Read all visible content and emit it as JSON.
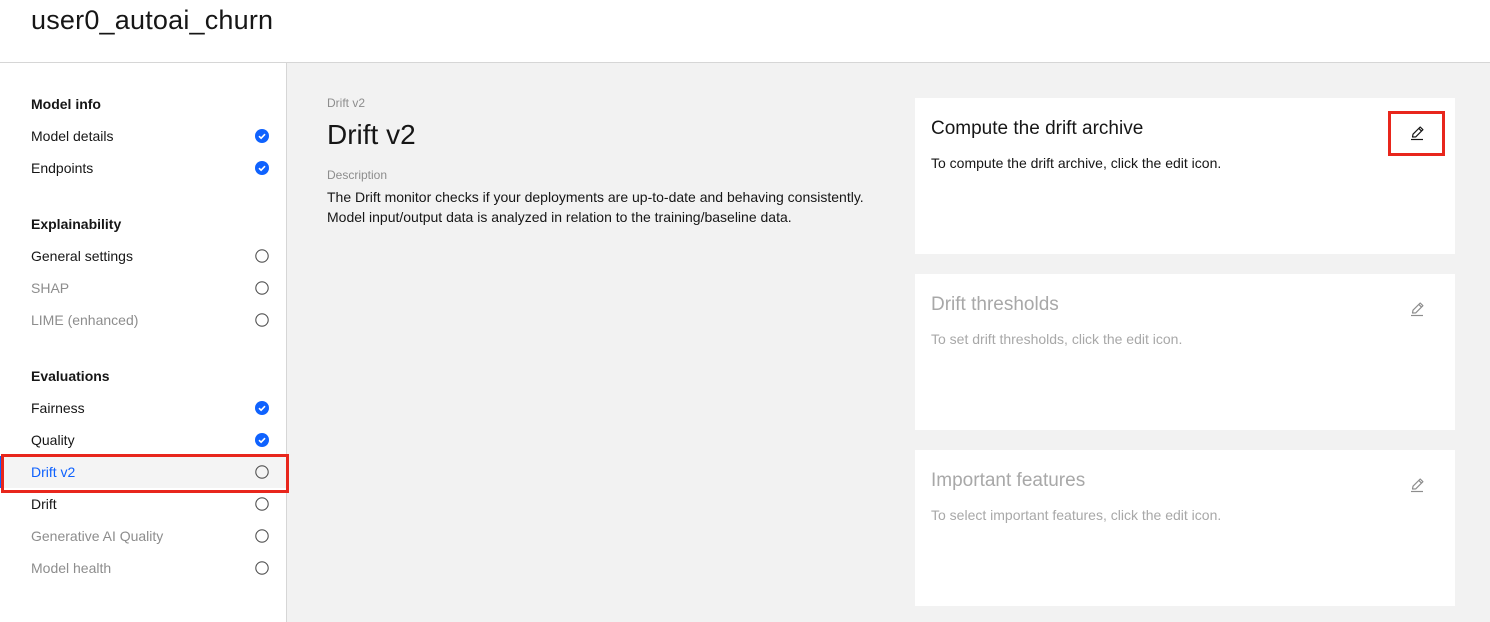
{
  "app": {
    "title": "user0_autoai_churn"
  },
  "sidebar": {
    "sections": [
      {
        "title": "Model info"
      },
      {
        "title": "Explainability"
      },
      {
        "title": "Evaluations"
      }
    ],
    "items": [
      {
        "label": "Model details",
        "status": "complete"
      },
      {
        "label": "Endpoints",
        "status": "complete"
      },
      {
        "label": "General settings",
        "status": "incomplete"
      },
      {
        "label": "SHAP",
        "status": "incomplete",
        "disabled": true
      },
      {
        "label": "LIME (enhanced)",
        "status": "incomplete",
        "disabled": true
      },
      {
        "label": "Fairness",
        "status": "complete"
      },
      {
        "label": "Quality",
        "status": "complete"
      },
      {
        "label": "Drift v2",
        "status": "incomplete",
        "selected": true
      },
      {
        "label": "Drift",
        "status": "incomplete"
      },
      {
        "label": "Generative AI Quality",
        "status": "incomplete",
        "disabled": true
      },
      {
        "label": "Model health",
        "status": "incomplete",
        "disabled": true
      }
    ]
  },
  "main": {
    "breadcrumb": "Drift v2",
    "title": "Drift v2",
    "description_label": "Description",
    "description": "The Drift monitor checks if your deployments are up-to-date and behaving consistently. Model input/output data is analyzed in relation to the training/baseline data.",
    "cards": [
      {
        "title": "Compute the drift archive",
        "text": "To compute the drift archive, click the edit icon.",
        "icon": "edit-icon"
      },
      {
        "title": "Drift thresholds",
        "text": "To set drift thresholds, click the edit icon.",
        "icon": "edit-icon",
        "disabled": true
      },
      {
        "title": "Important features",
        "text": "To select important features, click the edit icon.",
        "icon": "edit-icon",
        "disabled": true
      }
    ]
  },
  "colors": {
    "accent": "#0f62fe",
    "highlight": "#e8261c",
    "disabled_text": "#8d8d8d"
  }
}
